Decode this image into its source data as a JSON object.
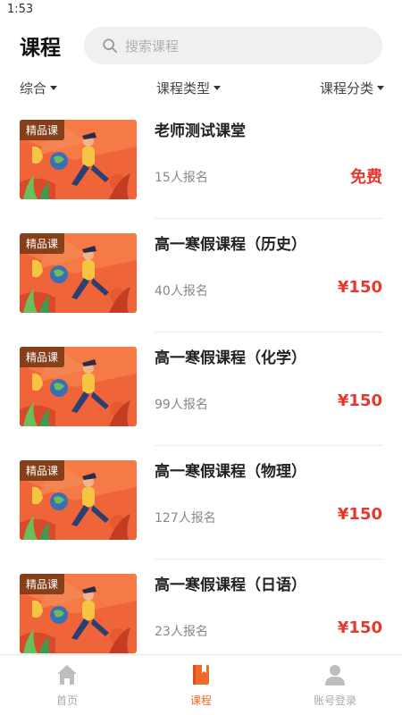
{
  "status": {
    "time": "1:53"
  },
  "header": {
    "title": "课程",
    "search_placeholder": "搜索课程"
  },
  "filters": [
    "综合",
    "课程类型",
    "课程分类"
  ],
  "courses": [
    {
      "badge": "精品课",
      "name": "老师测试课堂",
      "enroll": "15人报名",
      "price": "免费"
    },
    {
      "badge": "精品课",
      "name": "高一寒假课程（历史）",
      "enroll": "40人报名",
      "price": "¥150"
    },
    {
      "badge": "精品课",
      "name": "高一寒假课程（化学）",
      "enroll": "99人报名",
      "price": "¥150"
    },
    {
      "badge": "精品课",
      "name": "高一寒假课程（物理）",
      "enroll": "127人报名",
      "price": "¥150"
    },
    {
      "badge": "精品课",
      "name": "高一寒假课程（日语）",
      "enroll": "23人报名",
      "price": "¥150"
    }
  ],
  "tabs": [
    {
      "label": "首页",
      "icon": "home-icon",
      "active": false
    },
    {
      "label": "课程",
      "icon": "course-book-icon",
      "active": true
    },
    {
      "label": "账号登录",
      "icon": "user-icon",
      "active": false
    }
  ],
  "colors": {
    "accent": "#f06a2b",
    "price": "#e8382d",
    "search_bg": "#f0f0f0"
  }
}
